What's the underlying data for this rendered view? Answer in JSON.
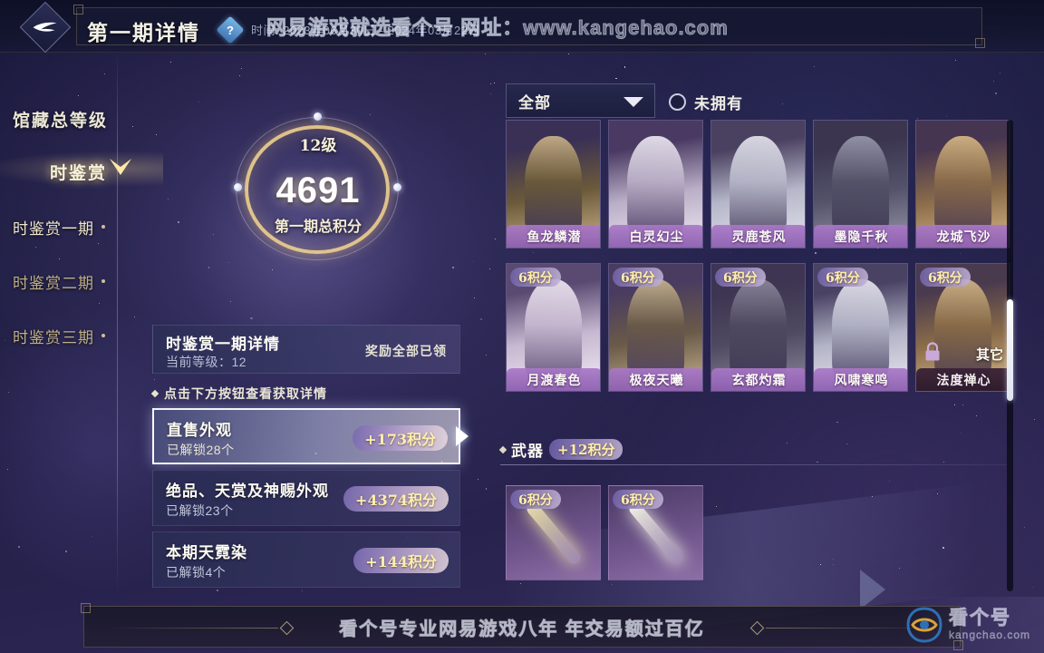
{
  "header": {
    "title": "第一期详情",
    "help_icon_label": "?",
    "time_range": "时间: 2023年06月30日 - 2024年03月22日",
    "logo_icon": "diamond-swoosh-logo"
  },
  "watermarks": {
    "top": "网易游戏就选看个号  网址：www.kangehao.com",
    "bottom_banner": "看个号专业网易游戏八年  年交易额过百亿",
    "corner_brand": "看个号",
    "corner_url": "kangchao.com",
    "corner_icon": "eye-logo-icon"
  },
  "sidebar": {
    "title": "馆藏总等级",
    "category": "时鉴赏",
    "items": [
      {
        "label": "时鉴赏一期",
        "active": true
      },
      {
        "label": "时鉴赏二期",
        "active": false
      },
      {
        "label": "时鉴赏三期",
        "active": false
      }
    ]
  },
  "score": {
    "level": "12级",
    "value": "4691",
    "label": "第一期总积分"
  },
  "detail": {
    "title": "时鉴赏一期详情",
    "current_level": "当前等级：12",
    "reward_status": "奖励全部已领",
    "hint": "点击下方按钮查看获取详情",
    "rewards": [
      {
        "name": "直售外观",
        "unlocked": "已解锁28个",
        "points": "+173积分",
        "selected": true
      },
      {
        "name": "绝品、天赏及神赐外观",
        "unlocked": "已解锁23个",
        "points": "+4374积分",
        "selected": false
      },
      {
        "name": "本期天霓染",
        "unlocked": "已解锁4个",
        "points": "+144积分",
        "selected": false
      }
    ]
  },
  "filter": {
    "selected": "全部",
    "caret_icon": "chevron-down-icon",
    "radio_label": "未拥有",
    "radio_checked": false
  },
  "gallery": {
    "row1": [
      {
        "name": "鱼龙鳞潜",
        "points": "",
        "locked": false,
        "c1": "#3a3055",
        "c2": "#6b5a3a",
        "c3": "#cdb58a"
      },
      {
        "name": "白灵幻尘",
        "points": "",
        "locked": false,
        "c1": "#4a3a63",
        "c2": "#b9aec6",
        "c3": "#f0ebf4"
      },
      {
        "name": "灵鹿苍风",
        "points": "",
        "locked": false,
        "c1": "#4a4060",
        "c2": "#b5b6c8",
        "c3": "#e6e6ee"
      },
      {
        "name": "墨隐千秋",
        "points": "",
        "locked": false,
        "c1": "#3b3550",
        "c2": "#54536a",
        "c3": "#9a9aad"
      },
      {
        "name": "龙城飞沙",
        "points": "",
        "locked": false,
        "c1": "#463550",
        "c2": "#8a6b4a",
        "c3": "#d9bb86"
      }
    ],
    "row2": [
      {
        "name": "月渡春色",
        "points": "6积分",
        "locked": false,
        "c1": "#5a4a72",
        "c2": "#c6b8d0",
        "c3": "#f2ecf6"
      },
      {
        "name": "极夜天曦",
        "points": "6积分",
        "locked": false,
        "c1": "#4a3c60",
        "c2": "#6a5a48",
        "c3": "#cbb893"
      },
      {
        "name": "玄都灼霜",
        "points": "6积分",
        "locked": false,
        "c1": "#3d3552",
        "c2": "#4f4a60",
        "c3": "#8f8a9e"
      },
      {
        "name": "风啸寒鸣",
        "points": "6积分",
        "locked": false,
        "c1": "#4a4263",
        "c2": "#b2b3c6",
        "c3": "#eceaf2"
      },
      {
        "name": "法度禅心",
        "points": "6积分",
        "locked": true,
        "other_tag": "其它",
        "lock_icon": "lock-icon",
        "c1": "#4a3a4e",
        "c2": "#8a6c48",
        "c3": "#d6bb8c"
      }
    ]
  },
  "weapon_section": {
    "label": "武器",
    "points": "+12积分",
    "items": [
      {
        "points": "6积分",
        "glow": "#e8dca8"
      },
      {
        "points": "6积分",
        "glow": "#f2f0e4"
      }
    ]
  },
  "scrollbar": {
    "present": true
  },
  "colors": {
    "gold": "#ecce8e",
    "panel_purple": "#8a5faf",
    "accent_white": "#ffffff",
    "points_text": "#ffeeaa"
  }
}
